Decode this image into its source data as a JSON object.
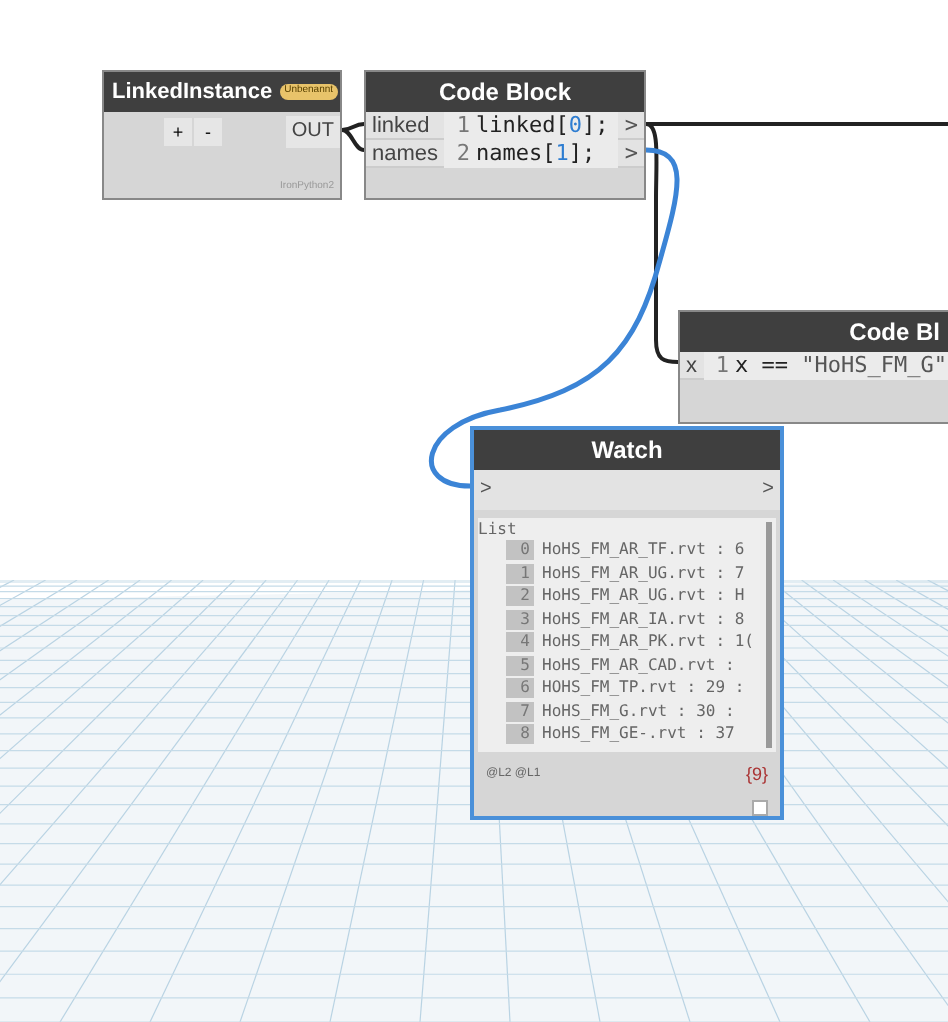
{
  "nodes": [
    {
      "kind": "python",
      "title": "LinkedInstance",
      "badge": "Unbenannt",
      "buttons": [
        "+",
        "-"
      ],
      "output": "OUT",
      "footer": "IronPython2"
    },
    {
      "kind": "code",
      "title": "Code Block",
      "inputs": [
        "linked",
        "names"
      ],
      "lines": [
        {
          "number": "1",
          "parts": [
            {
              "kind": "plain",
              "text": "linked["
            },
            {
              "kind": "num",
              "text": "0"
            },
            {
              "kind": "plain",
              "text": "];"
            }
          ]
        },
        {
          "number": "2",
          "parts": [
            {
              "kind": "plain",
              "text": "names["
            },
            {
              "kind": "num",
              "text": "1"
            },
            {
              "kind": "plain",
              "text": "];"
            }
          ]
        }
      ],
      "output": ">"
    },
    {
      "kind": "code",
      "title": "Code Bl",
      "inputs": [
        "x"
      ],
      "lines": [
        {
          "number": "1",
          "parts": [
            {
              "kind": "plain",
              "text": "x == "
            },
            {
              "kind": "str",
              "text": "\"HoHS_FM_G\""
            }
          ]
        }
      ]
    },
    {
      "kind": "watch",
      "title": "Watch",
      "input": ">",
      "output": ">",
      "list_label": "List",
      "items": [
        {
          "index": "0",
          "text": "HoHS_FM_AR_TF.rvt : 6"
        },
        {
          "index": "1",
          "text": "HoHS_FM_AR_UG.rvt : 7"
        },
        {
          "index": "2",
          "text": "HoHS_FM_AR_UG.rvt : H"
        },
        {
          "index": "3",
          "text": "HoHS_FM_AR_IA.rvt : 8"
        },
        {
          "index": "4",
          "text": "HoHS_FM_AR_PK.rvt : 1("
        },
        {
          "index": "5",
          "text": "HoHS_FM_AR_CAD.rvt :"
        },
        {
          "index": "6",
          "text": "HOHS_FM_TP.rvt : 29 :"
        },
        {
          "index": "7",
          "text": "HoHS_FM_G.rvt : 30 :"
        },
        {
          "index": "8",
          "text": "HoHS_FM_GE-.rvt : 37"
        }
      ],
      "levels": "@L2 @L1",
      "count": "{9}",
      "checked": false
    }
  ]
}
